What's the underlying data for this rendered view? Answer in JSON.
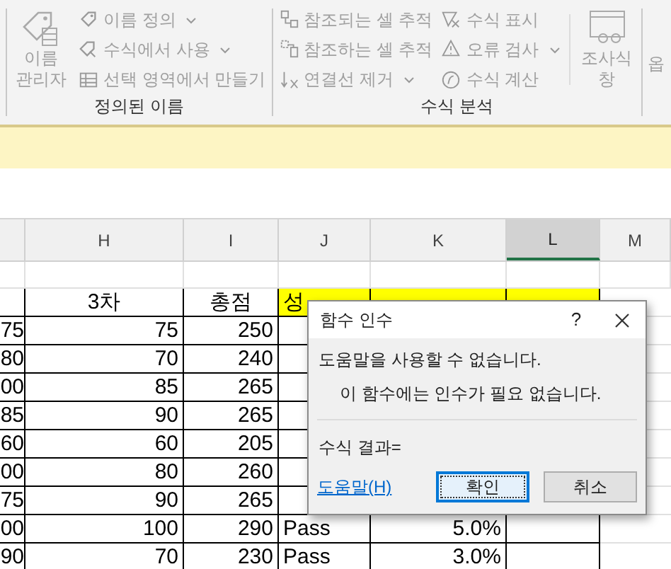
{
  "ribbon": {
    "groups": [
      {
        "label": "정의된 이름",
        "large_button": {
          "lines": [
            "이름",
            "관리자"
          ]
        },
        "columns": [
          [
            {
              "label": "이름 정의",
              "dropdown": true
            },
            {
              "label": "수식에서 사용",
              "dropdown": true
            },
            {
              "label": "선택 영역에서 만들기",
              "dropdown": false
            }
          ]
        ]
      },
      {
        "label": "수식 분석",
        "columns": [
          [
            {
              "label": "참조되는 셀 추적",
              "dropdown": false
            },
            {
              "label": "참조하는 셀 추적",
              "dropdown": false
            },
            {
              "label": "연결선 제거",
              "dropdown": true
            }
          ],
          [
            {
              "label": "수식 표시",
              "dropdown": false
            },
            {
              "label": "오류 검사",
              "dropdown": true
            },
            {
              "label": "수식 계산",
              "dropdown": false
            }
          ]
        ],
        "large_button": {
          "lines": [
            "조사식",
            "창"
          ]
        }
      }
    ],
    "cut_group": {
      "text": "옵"
    }
  },
  "sheet": {
    "columns": [
      {
        "label": "H",
        "selected": false
      },
      {
        "label": "I",
        "selected": false
      },
      {
        "label": "J",
        "selected": false
      },
      {
        "label": "K",
        "selected": false
      },
      {
        "label": "L",
        "selected": true
      },
      {
        "label": "M",
        "selected": false
      }
    ],
    "rows": [
      {
        "kind": "blank"
      },
      {
        "kind": "header",
        "cells": [
          {
            "text": "3차",
            "highlighted": false
          },
          {
            "text": "총점",
            "highlighted": false
          },
          {
            "text": "성",
            "highlighted": true
          },
          {
            "highlighted": true
          },
          {
            "highlighted": true
          },
          {
            "highlighted": false
          }
        ]
      },
      {
        "kind": "data",
        "column_g": "75",
        "cells": [
          "75",
          "250",
          null,
          null,
          null
        ]
      },
      {
        "kind": "data",
        "column_g": "80",
        "cells": [
          "70",
          "240",
          null,
          null,
          null
        ]
      },
      {
        "kind": "data",
        "column_g": "00",
        "cells": [
          "85",
          "265",
          null,
          null,
          null
        ]
      },
      {
        "kind": "data",
        "column_g": "85",
        "cells": [
          "90",
          "265",
          null,
          null,
          null
        ]
      },
      {
        "kind": "data",
        "column_g": "60",
        "cells": [
          "60",
          "205",
          null,
          null,
          null
        ]
      },
      {
        "kind": "data",
        "column_g": "00",
        "cells": [
          "80",
          "260",
          null,
          null,
          null
        ]
      },
      {
        "kind": "data",
        "column_g": "75",
        "cells": [
          "90",
          "265",
          null,
          null,
          null
        ]
      },
      {
        "kind": "data",
        "column_g": "00",
        "cells": [
          "100",
          "290",
          "Pass",
          "5.0%",
          null
        ]
      },
      {
        "kind": "data",
        "column_g": "90",
        "cells": [
          "70",
          "230",
          "Pass",
          "3.0%",
          null
        ]
      }
    ]
  },
  "dialog": {
    "title": "함수 인수",
    "help_glyph": "?",
    "message": "도움말을 사용할 수 없습니다.",
    "detail": "이 함수에는 인수가 필요 없습니다.",
    "result_label": "수식 결과=",
    "help_link": "도움말(H)",
    "buttons": [
      {
        "label": "확인",
        "focused": true
      },
      {
        "label": "취소",
        "focused": false
      }
    ]
  }
}
